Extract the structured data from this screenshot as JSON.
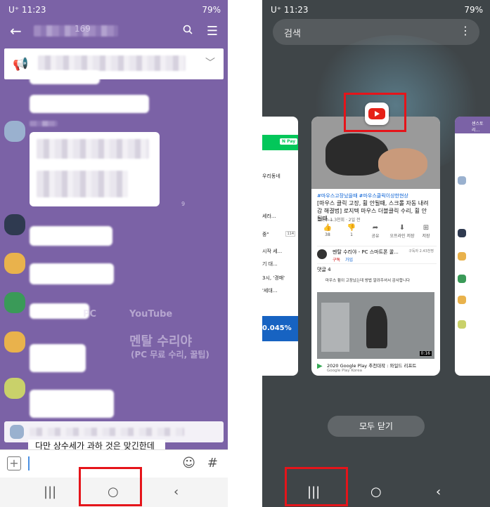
{
  "left": {
    "status": {
      "carrier": "U⁺ 11:23",
      "battery": "79%"
    },
    "toolbar": {
      "title_number": "169"
    },
    "reply_peek": "다만 상수세가 과하 것은 맞긴한데",
    "watermark": {
      "line1": "PC",
      "brand": "YouTube",
      "name": "멘탈 수리야",
      "sub": "(PC 무료 수리, 꿀팁)"
    },
    "time_fragment": "9",
    "compose_hash": "#",
    "nav": {
      "recents": "|||",
      "home": "○",
      "back": "‹"
    }
  },
  "right": {
    "status": {
      "carrier": "U⁺ 11:23",
      "battery": "79%"
    },
    "search": {
      "placeholder": "검색"
    },
    "youtube": {
      "tags": "#마우스고장났을때 #마우스클릭이상한현상",
      "title": "[마우스 클릭 고장, 휠 안될때, 스크롤 자동 내려감 해결법] 로지텍 마우스 더블클릭 수리, 휠 안될때...",
      "views": "조회수 1.3천회 · 2일 전",
      "actions": [
        {
          "icon": "thumbs-up-icon",
          "glyph": "👍",
          "label": "38"
        },
        {
          "icon": "thumbs-down-icon",
          "glyph": "👎",
          "label": "1"
        },
        {
          "icon": "share-icon",
          "glyph": "➦",
          "label": "공유"
        },
        {
          "icon": "download-icon",
          "glyph": "⬇",
          "label": "오프라인 저장"
        },
        {
          "icon": "save-icon",
          "glyph": "⊞",
          "label": "저장"
        }
      ],
      "channel": {
        "name": "멘탈 수리야 - PC 스마트폰 꿀...",
        "subs": "구독자 2.43천명",
        "subscribed": "구독",
        "join": "가입"
      },
      "comments": "댓글 4",
      "comment_line": "마우스 휠이 고장났는데 방법 알려주셔서 감사합니다",
      "duration": "0:16",
      "rec_title": "2020 Google Play 추천대작 : 와일드 리프트",
      "rec_sub": "Google Play Korea"
    },
    "left_card": {
      "npay": "N Pay",
      "area": "우리동네",
      "rows": [
        {
          "text": "세라...",
          "count": ""
        },
        {
          "text": "중\"",
          "count": "114"
        },
        {
          "text": "시작 세...",
          "count": ""
        },
        {
          "text": "기 대...",
          "count": ""
        },
        {
          "text": "3시, '경매'",
          "count": ""
        },
        {
          "text": "'세대...",
          "count": ""
        }
      ],
      "finance": "0.045%"
    },
    "right_card": {
      "header": "센스토리..."
    },
    "close_all": "모두 닫기",
    "nav": {
      "recents": "|||",
      "home": "○",
      "back": "‹"
    }
  }
}
